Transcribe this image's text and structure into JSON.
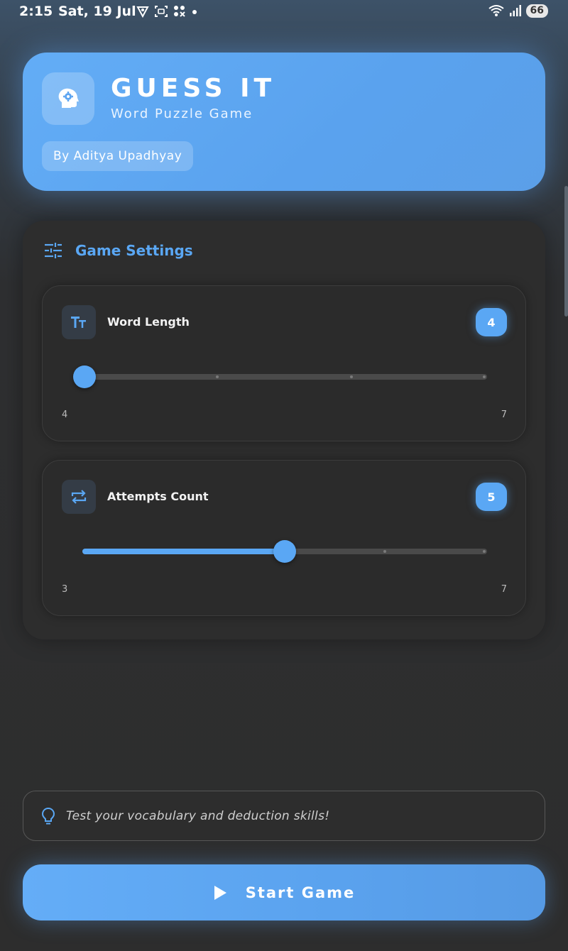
{
  "status_bar": {
    "time": "2:15",
    "date": "Sat, 19 Jul",
    "battery": "66",
    "icons": [
      "vpn-icon",
      "screenshot-icon",
      "app-grid-icon",
      "dot-icon",
      "wifi-icon",
      "signal-icon"
    ]
  },
  "header": {
    "title": "GUESS IT",
    "subtitle": "Word Puzzle Game",
    "author": "By Aditya Upadhyay",
    "icon": "brain-gear-icon"
  },
  "settings": {
    "title": "Game Settings",
    "icon": "tune-icon",
    "word_length": {
      "label": "Word Length",
      "value": "4",
      "min": "4",
      "max": "7",
      "level": 0,
      "icon": "text-size-icon"
    },
    "attempts": {
      "label": "Attempts Count",
      "value": "5",
      "min": "3",
      "max": "7",
      "level": 0.5,
      "icon": "repeat-icon"
    }
  },
  "tip": {
    "text": "Test your vocabulary and deduction skills!",
    "icon": "lightbulb-icon"
  },
  "start_button": {
    "label": "Start Game",
    "icon": "play-icon"
  },
  "colors": {
    "accent": "#5aa7f4",
    "background": "#2d2d2d",
    "card": "#2b2b2b"
  }
}
